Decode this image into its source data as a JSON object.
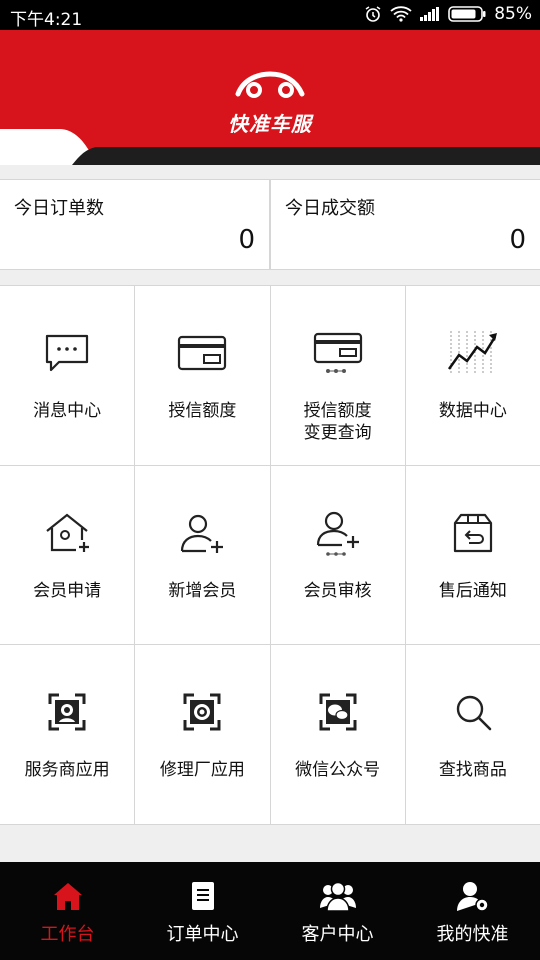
{
  "status_bar": {
    "time": "下午4:21",
    "battery": "85%"
  },
  "header": {
    "app_name": "快准车服"
  },
  "stats": [
    {
      "label": "今日订单数",
      "value": "0"
    },
    {
      "label": "今日成交额",
      "value": "0"
    }
  ],
  "grid": [
    {
      "label": "消息中心",
      "icon": "message-icon"
    },
    {
      "label": "授信额度",
      "icon": "credit-card-icon"
    },
    {
      "label": "授信额度\n变更查询",
      "icon": "credit-change-icon"
    },
    {
      "label": "数据中心",
      "icon": "chart-icon"
    },
    {
      "label": "会员申请",
      "icon": "house-add-icon"
    },
    {
      "label": "新增会员",
      "icon": "user-add-icon"
    },
    {
      "label": "会员审核",
      "icon": "user-review-icon"
    },
    {
      "label": "售后通知",
      "icon": "return-box-icon"
    },
    {
      "label": "服务商应用",
      "icon": "qr-person-icon"
    },
    {
      "label": "修理厂应用",
      "icon": "qr-gear-icon"
    },
    {
      "label": "微信公众号",
      "icon": "qr-wechat-icon"
    },
    {
      "label": "查找商品",
      "icon": "search-icon"
    }
  ],
  "tabs": [
    {
      "label": "工作台",
      "icon": "home-icon",
      "active": true
    },
    {
      "label": "订单中心",
      "icon": "document-icon",
      "active": false
    },
    {
      "label": "客户中心",
      "icon": "users-icon",
      "active": false
    },
    {
      "label": "我的快准",
      "icon": "user-settings-icon",
      "active": false
    }
  ],
  "colors": {
    "brand": "#d7141b",
    "tabbar": "#060606"
  }
}
